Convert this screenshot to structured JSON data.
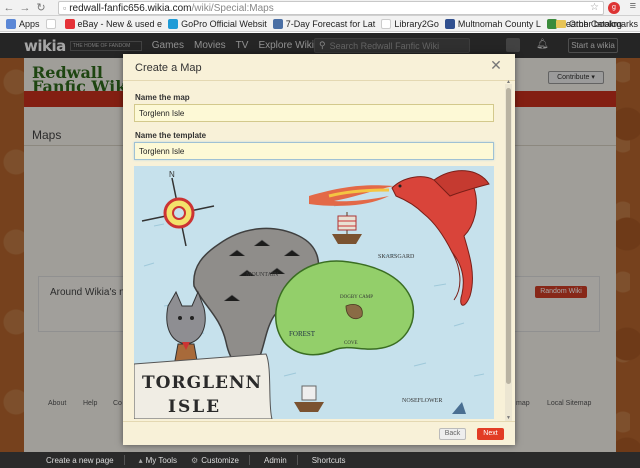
{
  "browser": {
    "url_host": "redwall-fanfic656.wikia.com",
    "url_path": "/wiki/Special:Maps",
    "back_icon": "back-arrow-icon",
    "forward_icon": "forward-arrow-icon",
    "reload_icon": "reload-icon"
  },
  "bookmarks": [
    {
      "label": "Apps",
      "color": "#5b87d6"
    },
    {
      "label": "eBay - New & used e",
      "color": "#e53238"
    },
    {
      "label": "GoPro Official Websit",
      "color": "#1f9bd7"
    },
    {
      "label": "7-Day Forecast for Lat",
      "color": "#4a6fa5"
    },
    {
      "label": "Library2Go",
      "color": "#888888"
    },
    {
      "label": "Multnomah County L",
      "color": "#2f4f8f"
    },
    {
      "label": "Search Catalog",
      "color": "#3b8b3b"
    }
  ],
  "other_bookmarks": "Other bookmarks",
  "wikia_nav": {
    "logo": "wikia",
    "tagline": "THE HOME OF FANDOM",
    "items": [
      "Games",
      "Movies",
      "TV",
      "Explore Wikia ▾"
    ],
    "search_placeholder": "Search Redwall Fanfic Wiki",
    "start_button": "Start a wikia"
  },
  "page": {
    "wiki_name": "Redwall Fanfic Wiki",
    "contribute": "Contribute ▾",
    "title": "Maps",
    "around_text": "Around Wikia's network",
    "random_wiki": "Random Wiki",
    "footer_links": [
      "About",
      "Help",
      "Co",
      "map",
      "Local Sitemap"
    ]
  },
  "bottom_bar": {
    "items": [
      "Create a new page",
      "My Tools",
      "Customize",
      "Admin",
      "Shortcuts"
    ]
  },
  "modal": {
    "title": "Create a Map",
    "name_label": "Name the map",
    "name_value": "Torglenn Isle",
    "template_label": "Name the template",
    "template_value": "Torglenn Isle",
    "map_labels": {
      "title_line1": "TORGLENN",
      "title_line2": "ISLE",
      "mountain": "MOUNTAIN",
      "forest": "FOREST",
      "coast": "SKARSGARD",
      "camp": "DOGBY CAMP",
      "cove": "COVE",
      "south": "NOSEFLOWER",
      "compass": "N"
    },
    "back_button": "Back",
    "next_button": "Next"
  }
}
